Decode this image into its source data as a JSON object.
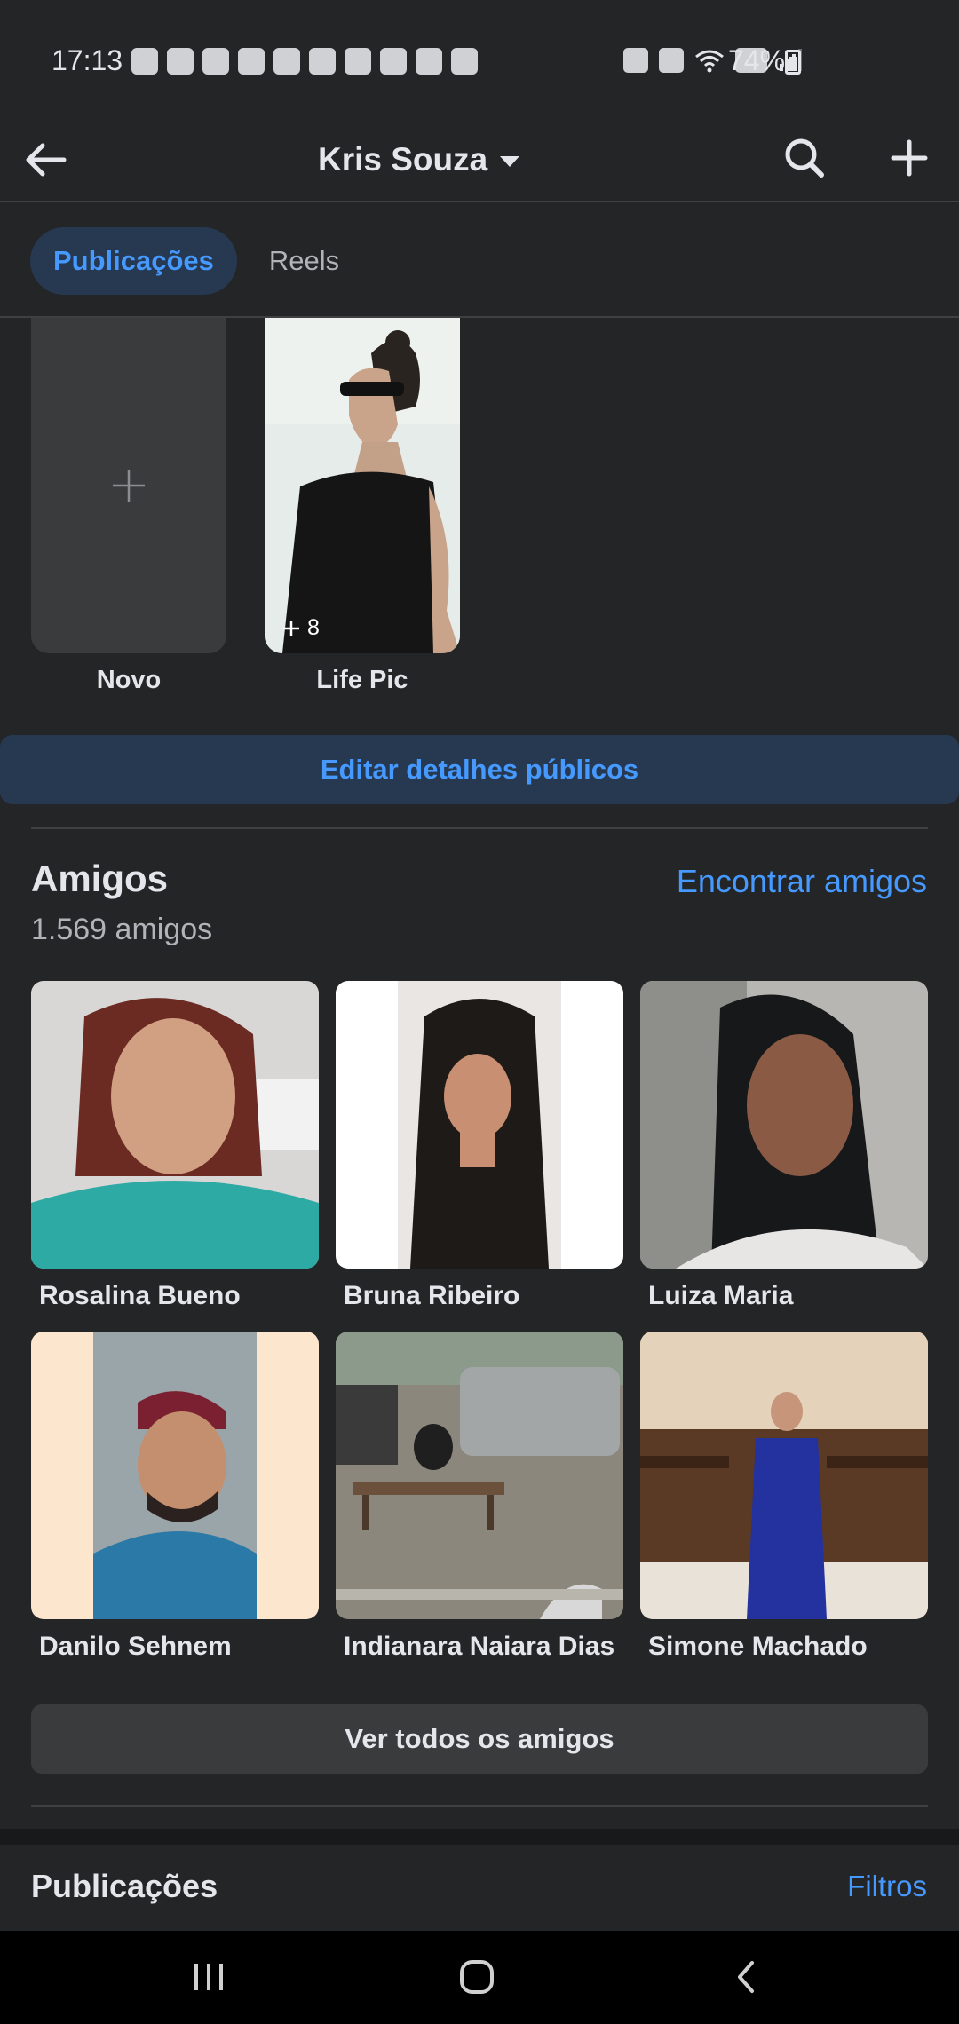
{
  "status_bar": {
    "time": "17:13",
    "battery": "74%",
    "battery_level": 0.74,
    "notification_icons": [
      "facebook-icon",
      "amazon-icon",
      "gmail-icon",
      "facebook-icon",
      "instagram-icon",
      "ifood-icon",
      "gallery-icon",
      "app-icon",
      "check-icon",
      "threads-icon"
    ],
    "system_icons": [
      "lock-icon",
      "alarm-icon",
      "wifi-icon",
      "volte-icon",
      "signal-icon"
    ]
  },
  "header": {
    "title": "Kris Souza",
    "back_icon": "arrow-left-icon",
    "search_icon": "search-icon",
    "add_icon": "plus-icon"
  },
  "tabs": [
    {
      "label": "Publicações",
      "active": true
    },
    {
      "label": "Reels",
      "active": false
    }
  ],
  "highlights": {
    "new_label": "Novo",
    "items": [
      {
        "label": "Life Pic",
        "count": "8"
      }
    ]
  },
  "edit_details_label": "Editar detalhes públicos",
  "friends": {
    "title": "Amigos",
    "find_label": "Encontrar amigos",
    "count": "1.569 amigos",
    "list": [
      {
        "name": "Rosalina Bueno"
      },
      {
        "name": "Bruna Ribeiro"
      },
      {
        "name": "Luiza Maria"
      },
      {
        "name": "Danilo Sehnem"
      },
      {
        "name": "Indianara Naiara Dias"
      },
      {
        "name": "Simone Machado"
      }
    ],
    "see_all_label": "Ver todos os amigos"
  },
  "posts": {
    "title": "Publicações",
    "filters_label": "Filtros"
  },
  "colors": {
    "background": "#242526",
    "accent": "#4599ff",
    "accent_bg": "#263951",
    "button_bg": "#3a3b3c",
    "text": "#e4e6eb",
    "secondary_text": "#b0b3b8"
  },
  "nav": {
    "recent_icon": "recent-apps-icon",
    "home_icon": "home-icon",
    "back_icon": "back-icon"
  }
}
